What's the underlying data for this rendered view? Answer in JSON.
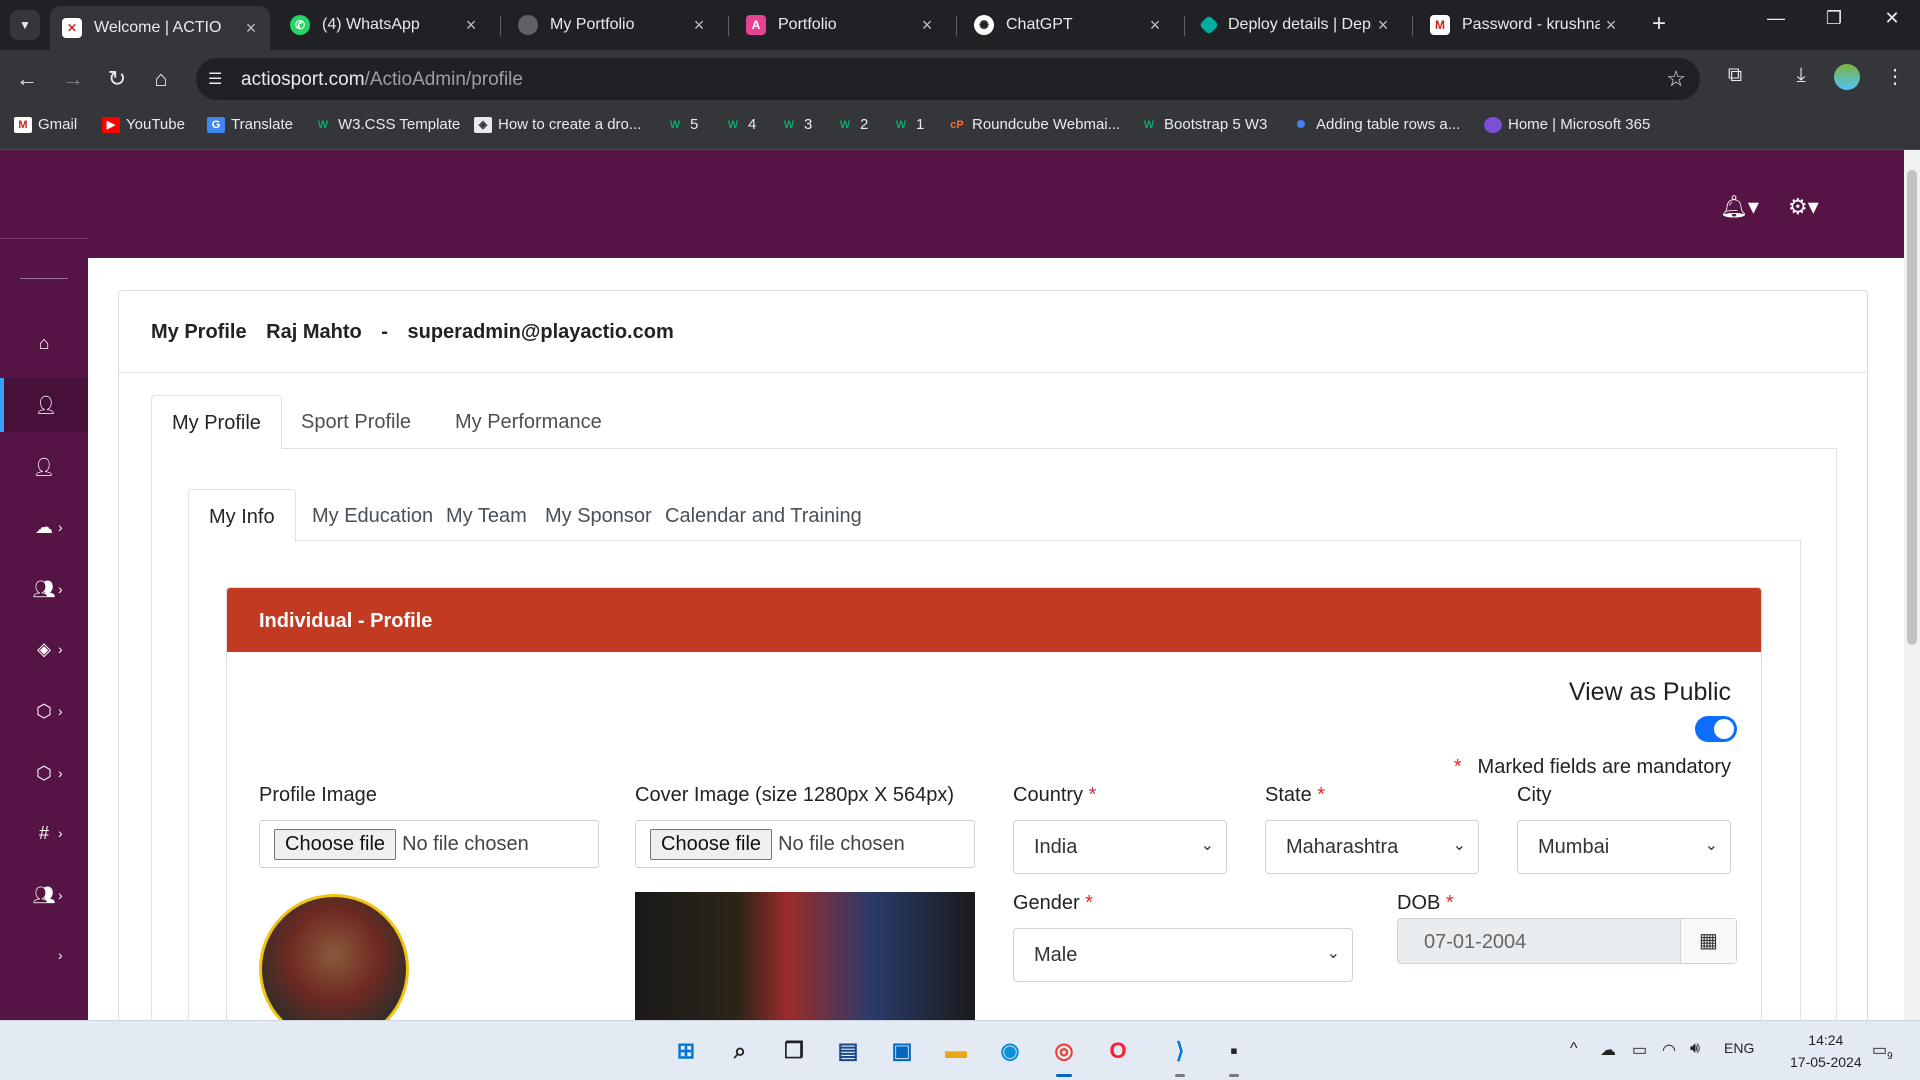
{
  "browser": {
    "tabs": [
      {
        "title": "Welcome | ACTIO",
        "active": true,
        "favicon_color": "#c0392b"
      },
      {
        "title": "(4) WhatsApp",
        "active": false,
        "favicon_color": "#25d366"
      },
      {
        "title": "My Portfolio",
        "active": false,
        "favicon_color": "#5f6368"
      },
      {
        "title": "Portfolio",
        "active": false,
        "favicon_color": "#e84393"
      },
      {
        "title": "ChatGPT",
        "active": false,
        "favicon_color": "#10a37f"
      },
      {
        "title": "Deploy details | Depl",
        "active": false,
        "favicon_color": "#00ad9f"
      },
      {
        "title": "Password - krushnap",
        "active": false,
        "favicon_color": "#c5221f"
      }
    ],
    "url_domain": "actiosport.com",
    "url_path": "/ActioAdmin/profile",
    "bookmarks": [
      {
        "label": "Gmail",
        "icon": "gmail-icon"
      },
      {
        "label": "YouTube",
        "icon": "youtube-icon"
      },
      {
        "label": "Translate",
        "icon": "translate-icon"
      },
      {
        "label": "W3.CSS Template",
        "icon": "w3-icon"
      },
      {
        "label": "How to create a dro...",
        "icon": "site-icon"
      },
      {
        "label": "5",
        "icon": "w3-icon"
      },
      {
        "label": "4",
        "icon": "w3-icon"
      },
      {
        "label": "3",
        "icon": "w3-icon"
      },
      {
        "label": "2",
        "icon": "w3-icon"
      },
      {
        "label": "1",
        "icon": "w3-icon"
      },
      {
        "label": "Roundcube Webmai...",
        "icon": "cpanel-icon"
      },
      {
        "label": "Bootstrap 5 W3",
        "icon": "w3-icon"
      },
      {
        "label": "Adding table rows a...",
        "icon": "site-icon"
      },
      {
        "label": "Home | Microsoft 365",
        "icon": "m365-icon"
      }
    ]
  },
  "app": {
    "brand_color": "#561445",
    "header": {
      "prefix": "My Profile",
      "user_name": "Raj Mahto",
      "separator": "-",
      "email": "superadmin@playactio.com"
    },
    "main_tabs": [
      "My Profile",
      "Sport Profile",
      "My Performance"
    ],
    "sub_tabs": [
      "My Info",
      "My Education",
      "My Team",
      "My Sponsor",
      "Calendar and Training"
    ],
    "panel_title": "Individual - Profile",
    "panel_color": "#c33a22",
    "view_as_public": {
      "label": "View as Public",
      "enabled": true
    },
    "mandatory_note": "Marked fields are mandatory",
    "required_marker": "*",
    "profile_image": {
      "label": "Profile Image",
      "button": "Choose file",
      "status": "No file chosen"
    },
    "cover_image": {
      "label": "Cover Image (size 1280px X 564px)",
      "button": "Choose file",
      "status": "No file chosen"
    },
    "country": {
      "label": "Country",
      "value": "India"
    },
    "state": {
      "label": "State",
      "value": "Maharashtra"
    },
    "city": {
      "label": "City",
      "value": "Mumbai"
    },
    "gender": {
      "label": "Gender",
      "value": "Male"
    },
    "dob": {
      "label": "DOB",
      "value": "07-01-2004"
    }
  },
  "taskbar": {
    "language": "ENG",
    "time": "14:24",
    "date": "17-05-2024",
    "notifications": "9"
  }
}
